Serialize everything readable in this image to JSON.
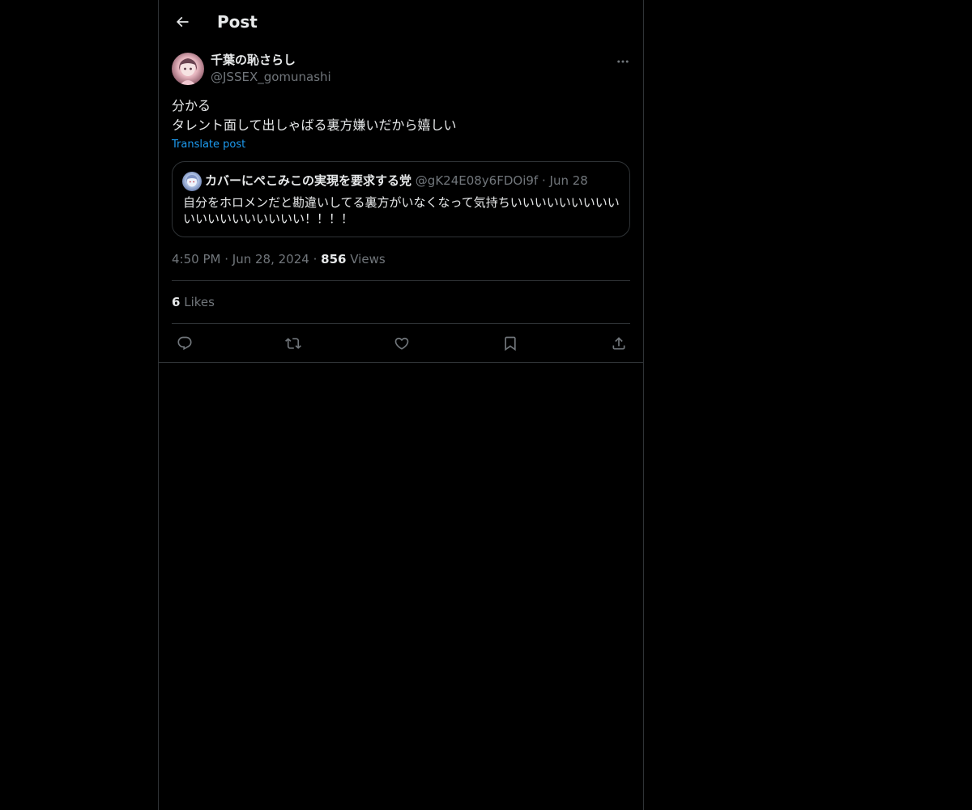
{
  "header": {
    "title": "Post",
    "back_icon": "arrow-left-icon"
  },
  "post": {
    "author_name": "千葉の恥さらし",
    "author_handle": "@JSSEX_gomunashi",
    "text_lines": [
      "分かる",
      "タレント面して出しゃばる裏方嫌いだから嬉しい"
    ],
    "translate_label": "Translate post",
    "time": "4:50 PM",
    "date": "Jun 28, 2024",
    "views_count": "856",
    "views_label": "Views",
    "likes_count": "6",
    "likes_label": "Likes"
  },
  "quote": {
    "author_name": "カバーにぺこみこの実現を要求する党",
    "author_handle": "@gK24E08y6FDOi9f",
    "date": "Jun 28",
    "text": "自分をホロメンだと勘違いしてる裏方がいなくなって気持ちいいいいいいいいいいいいいいいいいいい！！！！"
  },
  "separator": "·",
  "actions": [
    "reply-icon",
    "repost-icon",
    "like-icon",
    "bookmark-icon",
    "share-icon"
  ],
  "colors": {
    "background": "#000000",
    "text": "#e7e9ea",
    "secondary": "#71767b",
    "border": "#2f3336",
    "link": "#1d9bf0"
  }
}
